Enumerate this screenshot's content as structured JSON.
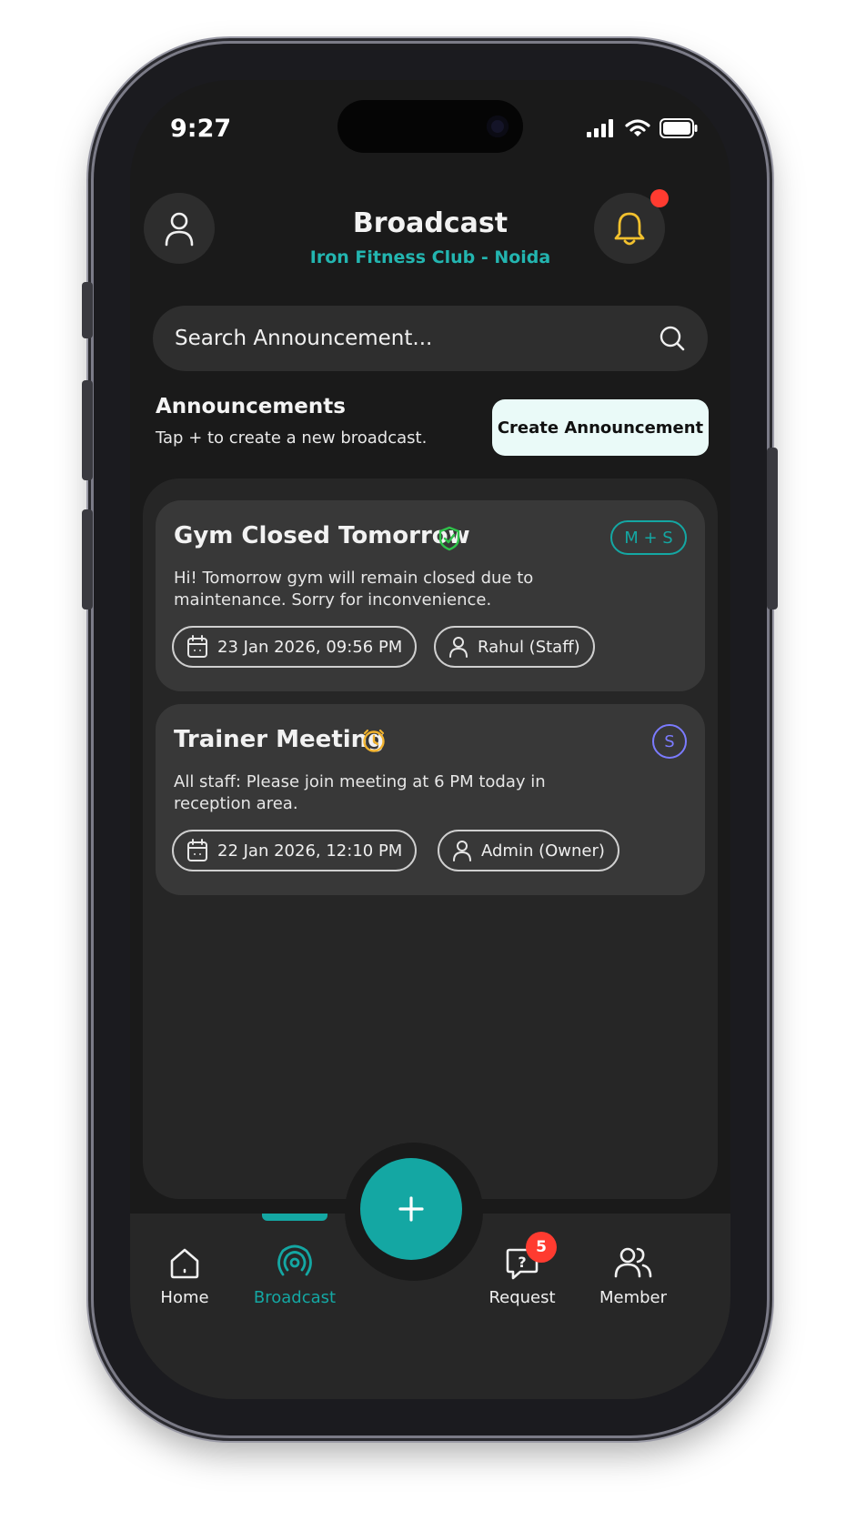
{
  "status_bar": {
    "time": "9:27"
  },
  "header": {
    "title": "Broadcast",
    "subtitle": "Iron Fitness Club - Noida",
    "profile_icon": "user-icon",
    "bell_icon": "bell-icon"
  },
  "search": {
    "placeholder": "Search Announcement..."
  },
  "announcements": {
    "title": "Announcements",
    "subtitle": "Tap + to create a new broadcast.",
    "create_label": "Create Announcement"
  },
  "cards": [
    {
      "title": "Gym Closed Tomorrow",
      "status_icon": "shield-check-icon",
      "tag": "M + S",
      "body": "Hi! Tomorrow gym will remain closed due to maintenance. Sorry for inconvenience.",
      "date": "23 Jan 2026, 09:56 PM",
      "author": "Rahul (Staff)"
    },
    {
      "title": "Trainer Meeting",
      "status_icon": "clock-icon",
      "tag": "S",
      "body": "All staff: Please join meeting at 6 PM today in reception area.",
      "date": "22 Jan 2026, 12:10 PM",
      "author": "Admin (Owner)"
    }
  ],
  "tabbar": {
    "home": "Home",
    "broadcast": "Broadcast",
    "request": "Request",
    "request_badge": "5",
    "member": "Member"
  },
  "colors": {
    "accent": "#14a7a3",
    "subtitle": "#23b5b0",
    "bell": "#f2c12e",
    "alert": "#ff3b30",
    "verified": "#2fc24a",
    "tag_s": "#7b7bff"
  }
}
